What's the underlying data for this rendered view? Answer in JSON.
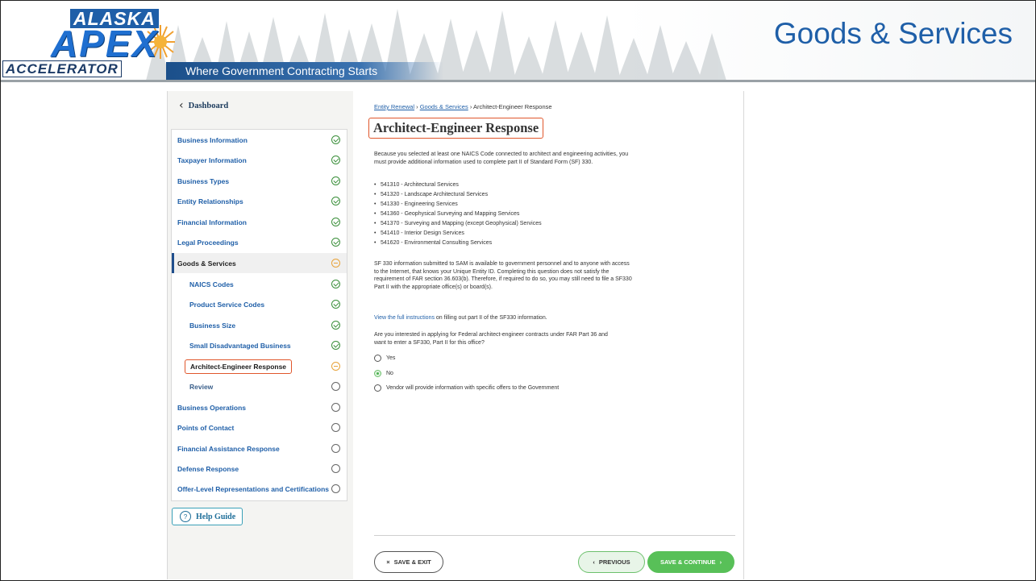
{
  "header": {
    "logo_line1": "ALASKA",
    "logo_line2": "APEX",
    "logo_line3": "ACCELERATOR",
    "tagline": "Where Government Contracting Starts",
    "title": "Goods & Services"
  },
  "sidebar": {
    "dashboard_label": "Dashboard",
    "items": [
      {
        "label": "Business Information",
        "status": "complete"
      },
      {
        "label": "Taxpayer Information",
        "status": "complete"
      },
      {
        "label": "Business Types",
        "status": "complete"
      },
      {
        "label": "Entity Relationships",
        "status": "complete"
      },
      {
        "label": "Financial Information",
        "status": "complete"
      },
      {
        "label": "Legal Proceedings",
        "status": "complete"
      },
      {
        "label": "Goods & Services",
        "status": "in-progress"
      },
      {
        "label": "NAICS Codes",
        "status": "complete"
      },
      {
        "label": "Product Service Codes",
        "status": "complete"
      },
      {
        "label": "Business Size",
        "status": "complete"
      },
      {
        "label": "Small Disadvantaged Business",
        "status": "complete"
      },
      {
        "label": "Architect-Engineer Response",
        "status": "in-progress"
      },
      {
        "label": "Review",
        "status": "not-started"
      },
      {
        "label": "Business Operations",
        "status": "not-started"
      },
      {
        "label": "Points of Contact",
        "status": "not-started"
      },
      {
        "label": "Financial Assistance Response",
        "status": "not-started"
      },
      {
        "label": "Defense Response",
        "status": "not-started"
      },
      {
        "label": "Offer-Level Representations and Certifications",
        "status": "not-started"
      }
    ],
    "help_label": "Help Guide"
  },
  "main": {
    "breadcrumb": {
      "part1": "Entity Renewal",
      "sep": " › ",
      "part2": "Goods & Services",
      "part3": "Architect-Engineer Response"
    },
    "heading": "Architect-Engineer Response",
    "intro": "Because you selected at least one NAICS Code connected to architect and engineering activities, you must provide additional information used to complete part II of Standard Form (SF) 330.",
    "codes": [
      "541310 - Architectural Services",
      "541320 - Landscape Architectural Services",
      "541330 - Engineering Services",
      "541360 - Geophysical Surveying and Mapping Services",
      "541370 - Surveying and Mapping (except Geophysical) Services",
      "541410 - Interior Design Services",
      "541620 - Environmental Consulting Services"
    ],
    "notice": "SF 330 information submitted to SAM is available to government personnel and to anyone with access to the Internet, that knows your Unique Entity ID. Completing this question does not satisfy the requirement of FAR section 36.603(b). Therefore, if required to do so, you may still need to file a SF330 Part II with the appropriate office(s) or board(s).",
    "instructions_link": "View the full instructions",
    "instructions_rest": " on filling out part II of the SF330 information.",
    "question": "Are you interested in applying for Federal architect-engineer contracts under FAR Part 36 and want to enter a SF330, Part II for this office?",
    "options": [
      {
        "label": "Yes",
        "selected": false
      },
      {
        "label": "No",
        "selected": true
      },
      {
        "label": "Vendor will provide information with specific offers to the Government",
        "selected": false
      }
    ],
    "buttons": {
      "save_exit": "SAVE & EXIT",
      "previous": "PREVIOUS",
      "save_continue": "SAVE & CONTINUE"
    }
  }
}
